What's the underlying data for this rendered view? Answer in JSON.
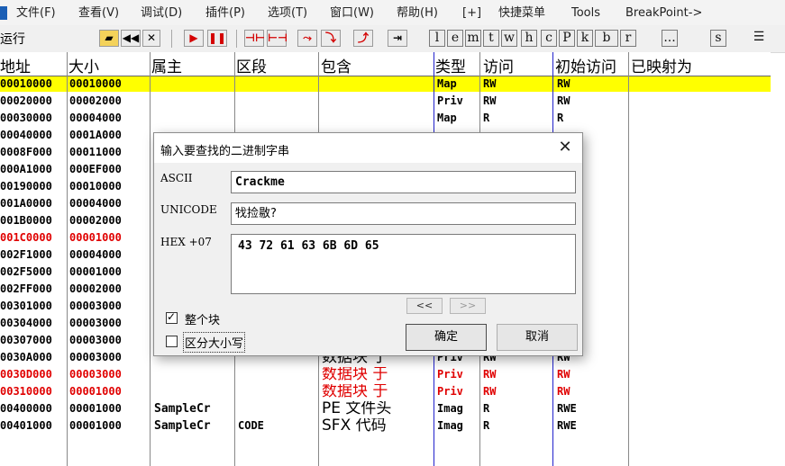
{
  "menubar": {
    "items": [
      "文件(F)",
      "查看(V)",
      "调试(D)",
      "插件(P)",
      "选项(T)",
      "窗口(W)",
      "帮助(H)",
      "[+]",
      "快捷菜单",
      "Tools",
      "BreakPoint->"
    ]
  },
  "toolbar": {
    "status": "运行",
    "buttons": [
      "◀◀",
      "✕",
      "▶",
      "❚❚",
      "⊣⊢",
      "⊢⊣",
      "⤳",
      "⤵",
      "⤴",
      "⇥"
    ],
    "letters": [
      "l",
      "e",
      "m",
      "t",
      "w",
      "h",
      "c",
      "P",
      "k",
      "b",
      "r",
      "...",
      "s"
    ],
    "list_icon": "☰"
  },
  "table": {
    "headers": {
      "address": "地址",
      "size": "大小",
      "owner": "属主",
      "section": "区段",
      "contains": "包含",
      "type": "类型",
      "access": "访问",
      "initial_access": "初始访问",
      "mapped_as": "已映射为"
    },
    "rows": [
      {
        "address": "00010000",
        "size": "00010000",
        "owner": "",
        "section": "",
        "contains": "",
        "type": "Map",
        "access": "RW",
        "initial_access": "RW",
        "style": "selected"
      },
      {
        "address": "00020000",
        "size": "00002000",
        "owner": "",
        "section": "",
        "contains": "",
        "type": "Priv",
        "access": "RW",
        "initial_access": "RW",
        "style": "normal"
      },
      {
        "address": "00030000",
        "size": "00004000",
        "owner": "",
        "section": "",
        "contains": "",
        "type": "Map",
        "access": "R",
        "initial_access": "R",
        "style": "normal"
      },
      {
        "address": "00040000",
        "size": "0001A000",
        "owner": "",
        "section": "",
        "contains": "",
        "type": "",
        "access": "",
        "initial_access": "",
        "style": "normal"
      },
      {
        "address": "0008F000",
        "size": "00011000",
        "owner": "",
        "section": "",
        "contains": "",
        "type": "",
        "access": "",
        "initial_access": "",
        "style": "normal"
      },
      {
        "address": "000A1000",
        "size": "000EF000",
        "owner": "",
        "section": "",
        "contains": "",
        "type": "",
        "access": "",
        "initial_access": "",
        "style": "normal"
      },
      {
        "address": "00190000",
        "size": "00010000",
        "owner": "",
        "section": "",
        "contains": "",
        "type": "",
        "access": "",
        "initial_access": "",
        "style": "normal"
      },
      {
        "address": "001A0000",
        "size": "00004000",
        "owner": "",
        "section": "",
        "contains": "",
        "type": "",
        "access": "",
        "initial_access": "",
        "style": "normal"
      },
      {
        "address": "001B0000",
        "size": "00002000",
        "owner": "",
        "section": "",
        "contains": "",
        "type": "",
        "access": "",
        "initial_access": "",
        "style": "normal"
      },
      {
        "address": "001C0000",
        "size": "00001000",
        "owner": "",
        "section": "",
        "contains": "",
        "type": "",
        "access": "",
        "initial_access": "",
        "style": "red"
      },
      {
        "address": "002F1000",
        "size": "00004000",
        "owner": "",
        "section": "",
        "contains": "",
        "type": "",
        "access": "",
        "initial_access": "",
        "style": "normal"
      },
      {
        "address": "002F5000",
        "size": "00001000",
        "owner": "",
        "section": "",
        "contains": "",
        "type": "",
        "access": "",
        "initial_access": "",
        "style": "normal"
      },
      {
        "address": "002FF000",
        "size": "00002000",
        "owner": "",
        "section": "",
        "contains": "",
        "type": "",
        "access": "",
        "initial_access": "",
        "style": "normal"
      },
      {
        "address": "00301000",
        "size": "00003000",
        "owner": "",
        "section": "",
        "contains": "",
        "type": "",
        "access": "",
        "initial_access": "",
        "style": "normal"
      },
      {
        "address": "00304000",
        "size": "00003000",
        "owner": "",
        "section": "",
        "contains": "",
        "type": "",
        "access": "",
        "initial_access": "",
        "style": "normal"
      },
      {
        "address": "00307000",
        "size": "00003000",
        "owner": "",
        "section": "",
        "contains": "数据块 于",
        "type": "Priv",
        "access": "RW",
        "initial_access": "RW",
        "style": "normal"
      },
      {
        "address": "0030A000",
        "size": "00003000",
        "owner": "",
        "section": "",
        "contains": "数据块 于",
        "type": "Priv",
        "access": "RW",
        "initial_access": "RW",
        "style": "normal"
      },
      {
        "address": "0030D000",
        "size": "00003000",
        "owner": "",
        "section": "",
        "contains": "数据块 于",
        "type": "Priv",
        "access": "RW",
        "initial_access": "RW",
        "style": "red"
      },
      {
        "address": "00310000",
        "size": "00001000",
        "owner": "",
        "section": "",
        "contains": "数据块 于",
        "type": "Priv",
        "access": "RW",
        "initial_access": "RW",
        "style": "red"
      },
      {
        "address": "00400000",
        "size": "00001000",
        "owner": "SampleCr",
        "section": "",
        "contains": "PE 文件头",
        "type": "Imag",
        "access": "R",
        "initial_access": "RWE",
        "style": "normal"
      },
      {
        "address": "00401000",
        "size": "00001000",
        "owner": "SampleCr",
        "section": "CODE",
        "contains": "SFX 代码",
        "type": "Imag",
        "access": "R",
        "initial_access": "RWE",
        "style": "normal"
      }
    ]
  },
  "dialog": {
    "title": "输入要查找的二进制字串",
    "close_glyph": "✕",
    "ascii_label": "ASCII",
    "ascii_value": "Crackme",
    "unicode_label": "UNICODE",
    "unicode_value": "牫捡敭?",
    "hex_label": "HEX +07",
    "hex_value": "43 72 61 63 6B 6D 65",
    "prev_label": "<<",
    "next_label": ">>",
    "entire_block_label": "整个块",
    "entire_block_checked": true,
    "case_sensitive_label": "区分大小写",
    "case_sensitive_checked": false,
    "ok_label": "确定",
    "cancel_label": "取消"
  },
  "colors": {
    "selected_row": "#ffff00",
    "red_text": "#e00000",
    "column_blue": "#2222cc"
  }
}
